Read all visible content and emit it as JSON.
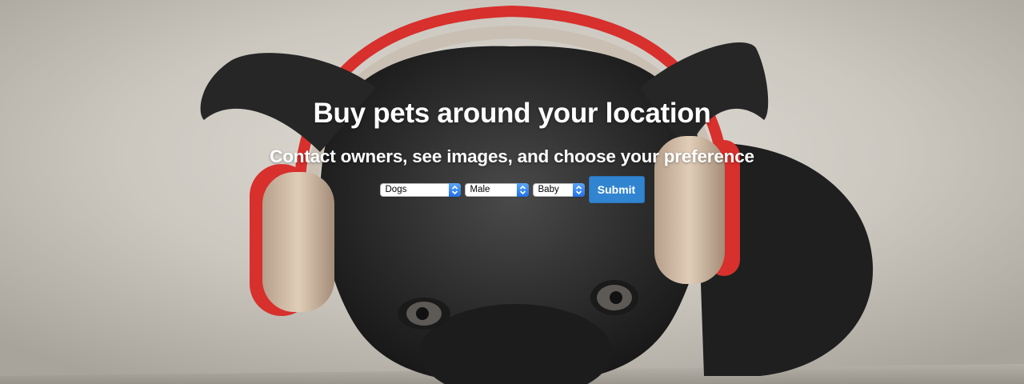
{
  "hero": {
    "title": "Buy pets around your location",
    "subtitle": "Contact owners, see images, and choose your preference",
    "background_image": "black-dog-wearing-red-headphones"
  },
  "search_form": {
    "pet_type": {
      "selected": "Dogs"
    },
    "gender": {
      "selected": "Male"
    },
    "age": {
      "selected": "Baby"
    },
    "submit_label": "Submit"
  },
  "colors": {
    "title_text": "#ffffff",
    "submit_button": "#3184d0",
    "select_arrow": "#2f7fea",
    "headphone_red": "#d7302d"
  },
  "icons": {
    "select_arrows": "up-down-chevron-icon"
  }
}
